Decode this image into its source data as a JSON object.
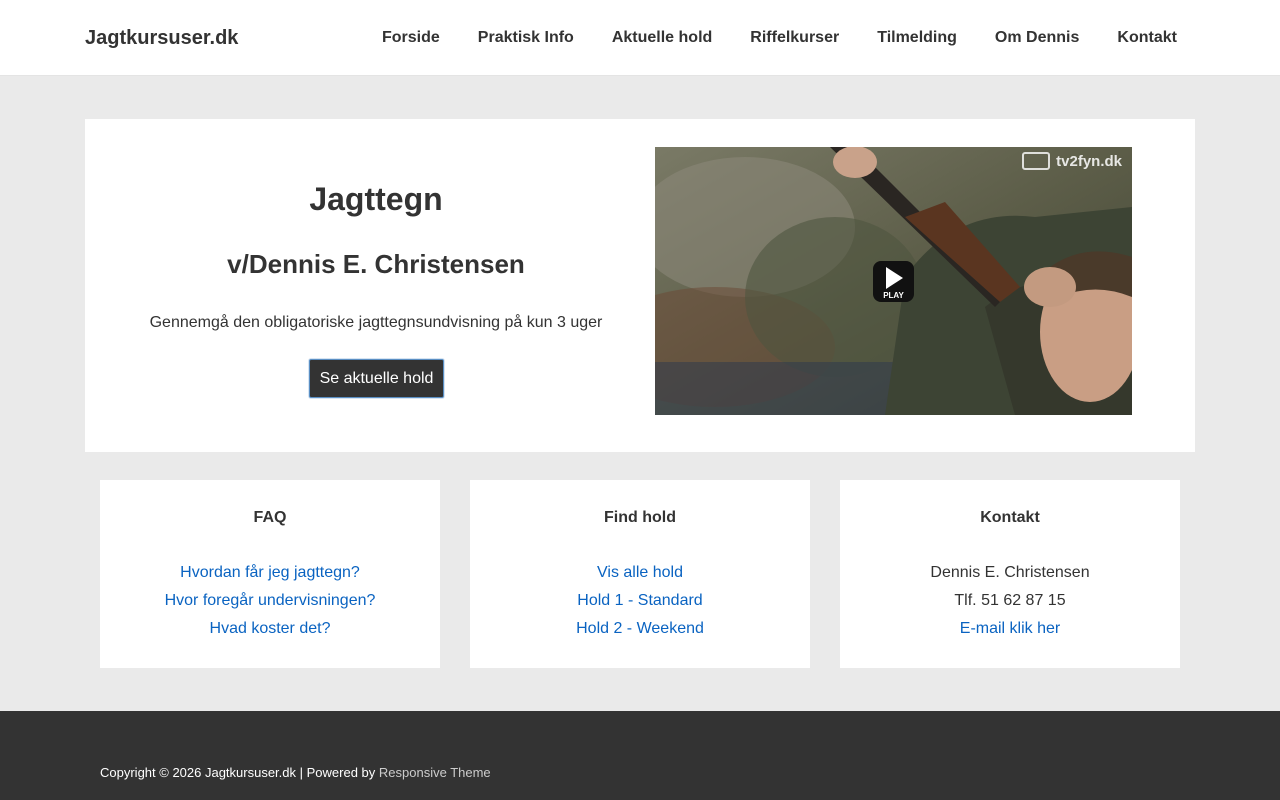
{
  "header": {
    "site_title": "Jagtkursuser.dk",
    "nav": [
      "Forside",
      "Praktisk Info",
      "Aktuelle hold",
      "Riffelkurser",
      "Tilmelding",
      "Om Dennis",
      "Kontakt"
    ]
  },
  "hero": {
    "title": "Jagttegn",
    "subtitle": "v/Dennis E. Christensen",
    "text": "Gennemgå den obligatoriske jagttegnsundvisning på kun 3 uger",
    "button": "Se aktuelle hold",
    "video": {
      "watermark": "tv2fyn.dk",
      "play_label": "PLAY"
    }
  },
  "boxes": {
    "faq": {
      "title": "FAQ",
      "links": [
        "Hvordan får jeg jagttegn?",
        "Hvor foregår undervisningen?",
        "Hvad koster det?"
      ]
    },
    "find": {
      "title": "Find hold",
      "links": [
        "Vis alle hold",
        "Hold 1 - Standard",
        "Hold 2 - Weekend"
      ]
    },
    "contact": {
      "title": "Kontakt",
      "name": "Dennis E. Christensen",
      "phone": "Tlf. 51 62 87 15",
      "email_link": "E-mail klik her"
    }
  },
  "footer": {
    "copyright": "Copyright © 2026 Jagtkursuser.dk | Powered by ",
    "theme_link": "Responsive Theme"
  },
  "colors": {
    "link": "#0a63c1",
    "footer_bg": "#333333",
    "page_bg": "#eaeaea",
    "button_bg": "#333333"
  }
}
